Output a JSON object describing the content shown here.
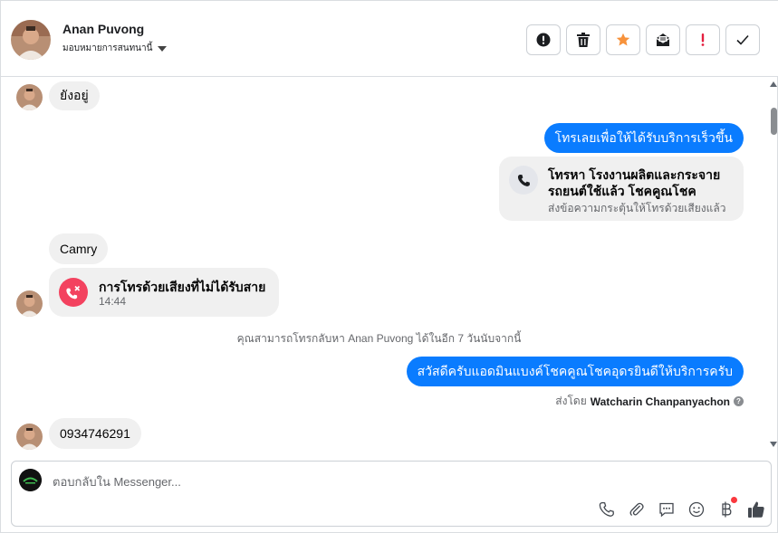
{
  "colors": {
    "accent": "#0a7cff",
    "incoming_bubble": "#f0f0f0",
    "missed_call": "#f3425f",
    "star": "#f7923b",
    "important": "#e41e3f"
  },
  "header": {
    "contact_name": "Anan Puvong",
    "assign_label": "มอบหมายการสนทนานี้",
    "actions": [
      {
        "name": "report-spam",
        "icon": "alert-circle-icon"
      },
      {
        "name": "delete",
        "icon": "trash-icon"
      },
      {
        "name": "star",
        "icon": "star-icon"
      },
      {
        "name": "mark-unread",
        "icon": "envelope-open-icon"
      },
      {
        "name": "important",
        "icon": "exclamation-icon"
      },
      {
        "name": "mark-done",
        "icon": "checkmark-icon"
      }
    ]
  },
  "thread": {
    "msg_1": "ยังอยู่",
    "msg_2": "โทรเลยเพื่อให้ได้รับบริการเร็วขึ้น",
    "call_card": {
      "title_line1": "โทรหา โรงงานผลิตและกระจาย",
      "title_line2": "รถยนต์ใช้แล้ว โชคคูณโชค",
      "subtitle": "ส่งข้อความกระตุ้นให้โทรด้วยเสียงแล้ว"
    },
    "msg_3": "Camry",
    "missed_call": {
      "title": "การโทรด้วยเสียงที่ไม่ได้รับสาย",
      "time": "14:44"
    },
    "notice": "คุณสามารถโทรกลับหา Anan Puvong ได้ในอีก 7 วันนับจากนี้",
    "msg_4": "สวัสดีครับแอดมินแบงค์โชคคูณโชคอุดรยินดีให้บริการครับ",
    "sent_by_prefix": "ส่งโดย",
    "sent_by_name": "Watcharin Chanpanyachon",
    "msg_5": "0934746291"
  },
  "composer": {
    "placeholder": "ตอบกลับใน Messenger...",
    "tools": [
      "phone-icon",
      "paperclip-icon",
      "saved-reply-icon",
      "emoji-icon",
      "baht-payment-icon",
      "thumbs-up-icon"
    ]
  }
}
